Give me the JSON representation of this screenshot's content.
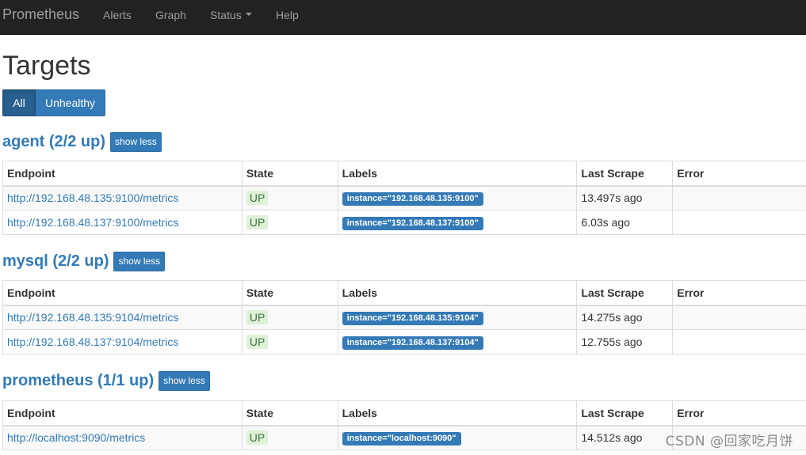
{
  "navbar": {
    "brand": "Prometheus",
    "items": [
      {
        "label": "Alerts"
      },
      {
        "label": "Graph"
      },
      {
        "label": "Status"
      },
      {
        "label": "Help"
      }
    ]
  },
  "page": {
    "title": "Targets"
  },
  "filters": {
    "all_label": "All",
    "unhealthy_label": "Unhealthy",
    "active": "All"
  },
  "columns": {
    "endpoint": "Endpoint",
    "state": "State",
    "labels": "Labels",
    "last_scrape": "Last Scrape",
    "error": "Error"
  },
  "jobs": [
    {
      "title": "agent (2/2 up)",
      "toggle_label": "show less",
      "targets": [
        {
          "endpoint": "http://192.168.48.135:9100/metrics",
          "state": "UP",
          "label": "instance=\"192.168.48.135:9100\"",
          "last_scrape": "13.497s ago",
          "error": ""
        },
        {
          "endpoint": "http://192.168.48.137:9100/metrics",
          "state": "UP",
          "label": "instance=\"192.168.48.137:9100\"",
          "last_scrape": "6.03s ago",
          "error": ""
        }
      ]
    },
    {
      "title": "mysql (2/2 up)",
      "toggle_label": "show less",
      "targets": [
        {
          "endpoint": "http://192.168.48.135:9104/metrics",
          "state": "UP",
          "label": "instance=\"192.168.48.135:9104\"",
          "last_scrape": "14.275s ago",
          "error": ""
        },
        {
          "endpoint": "http://192.168.48.137:9104/metrics",
          "state": "UP",
          "label": "instance=\"192.168.48.137:9104\"",
          "last_scrape": "12.755s ago",
          "error": ""
        }
      ]
    },
    {
      "title": "prometheus (1/1 up)",
      "toggle_label": "show less",
      "targets": [
        {
          "endpoint": "http://localhost:9090/metrics",
          "state": "UP",
          "label": "instance=\"localhost:9090\"",
          "last_scrape": "14.512s ago",
          "error": ""
        }
      ]
    }
  ],
  "watermark": "CSDN @回家吃月饼",
  "colors": {
    "navbar_bg": "#222222",
    "link": "#337ab7",
    "up_text": "#3c763d",
    "up_bg": "#dff0d8"
  }
}
